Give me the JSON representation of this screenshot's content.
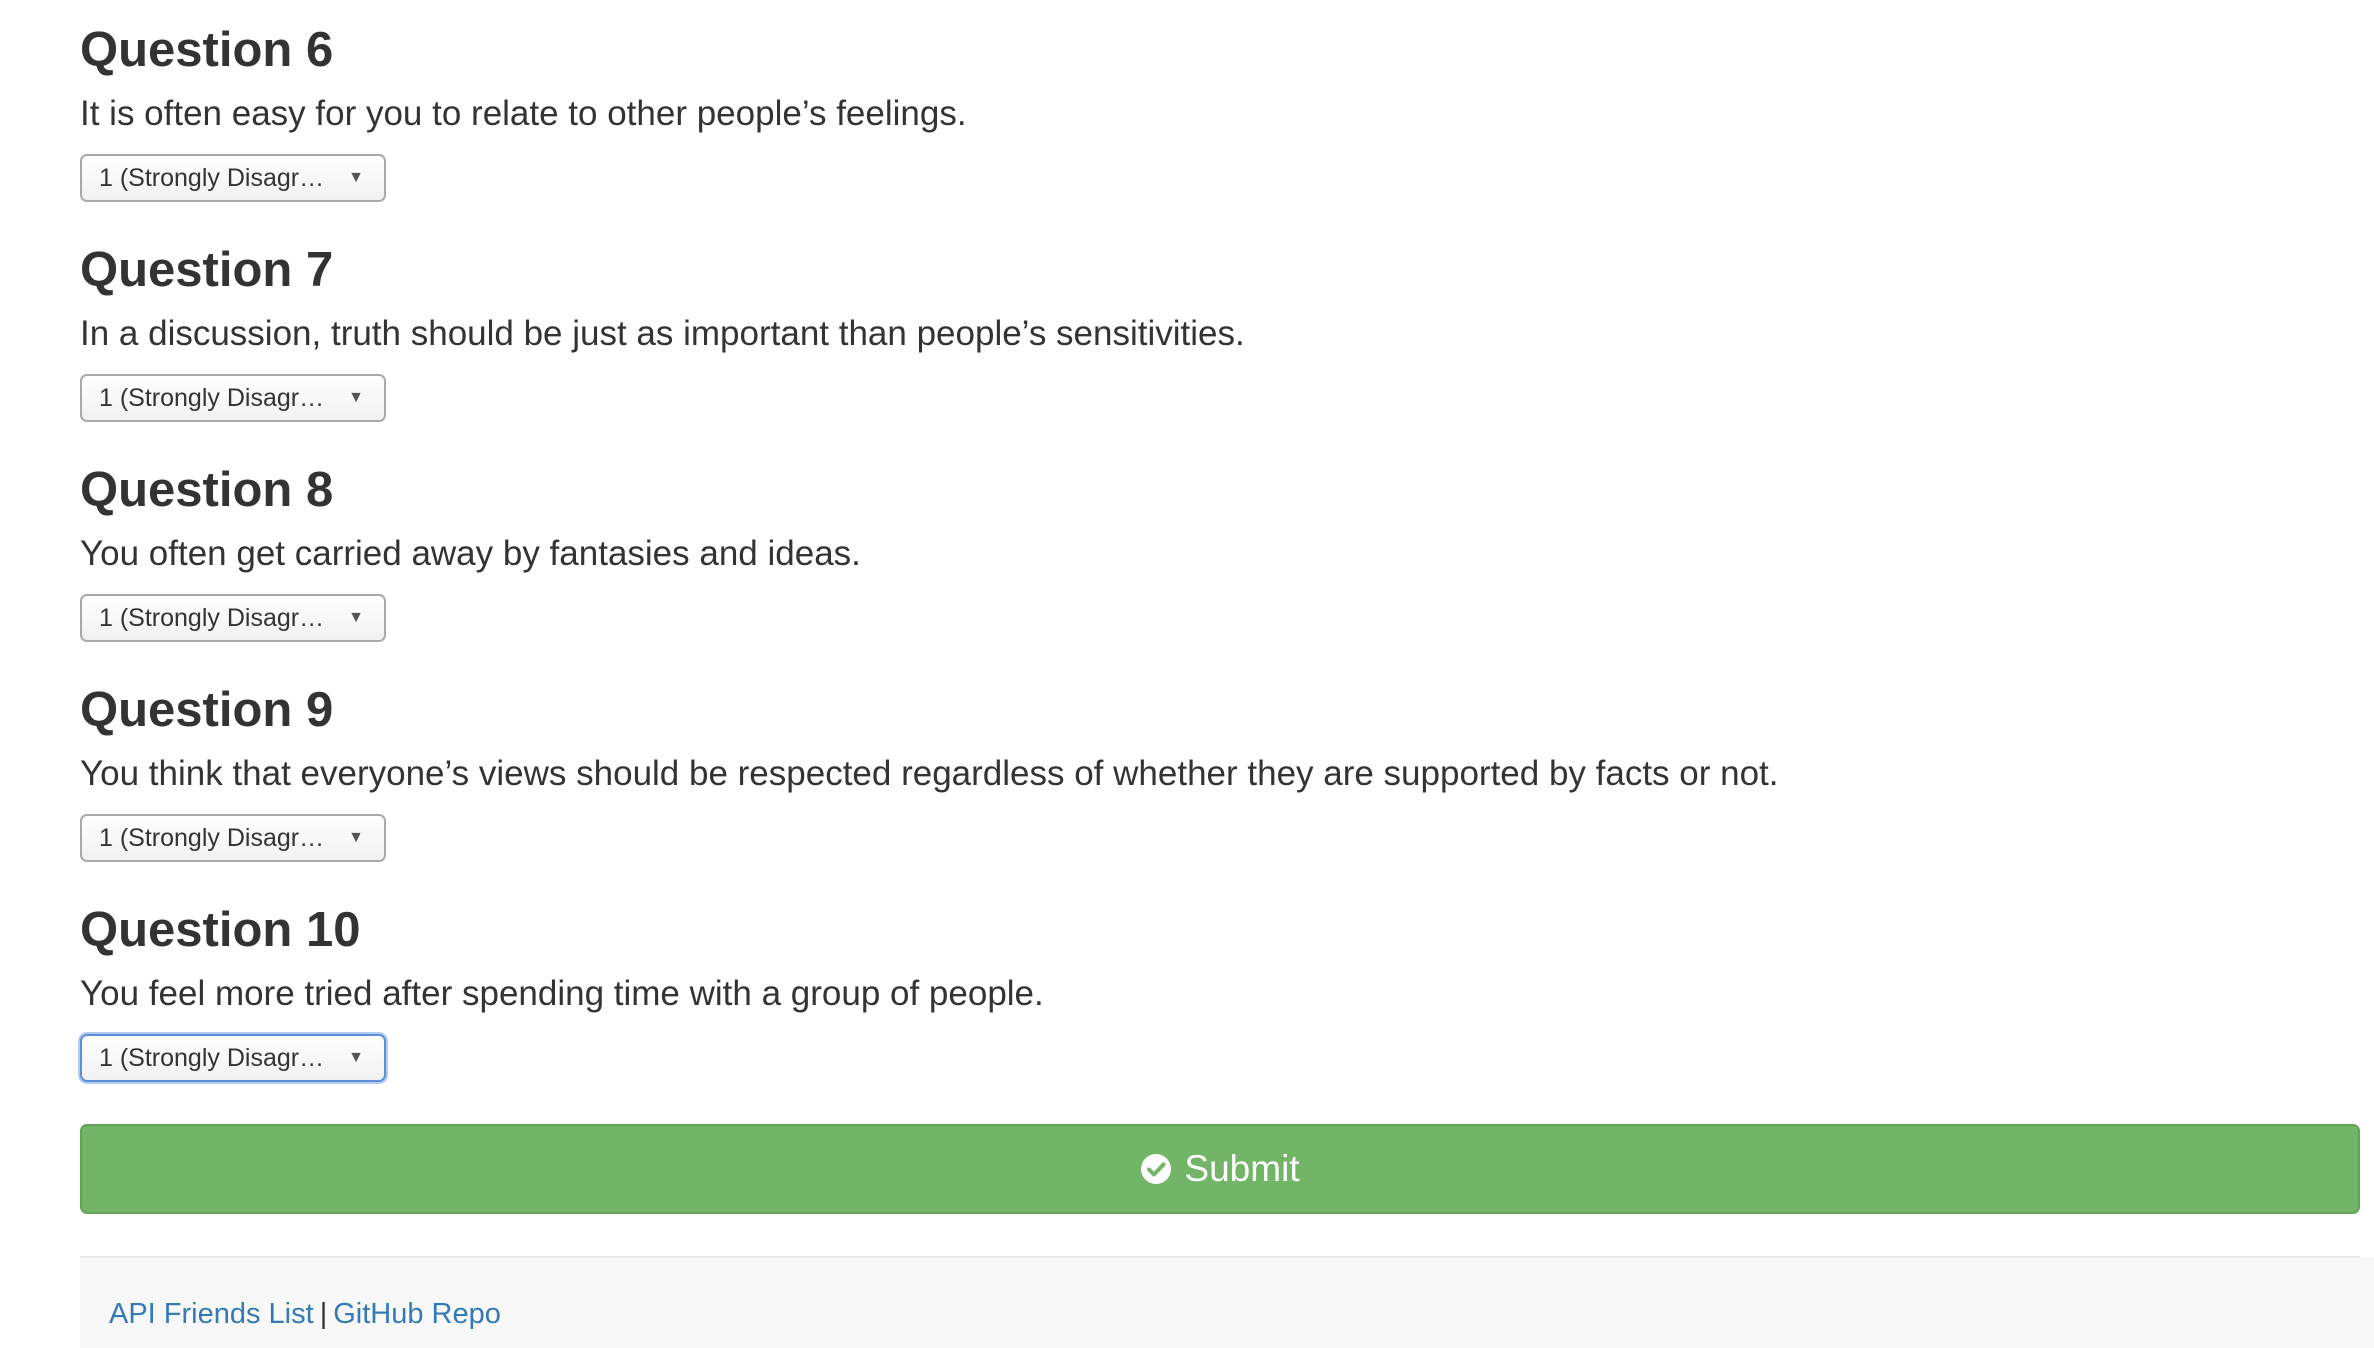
{
  "questions": [
    {
      "title": "Question 6",
      "text": "It is often easy for you to relate to other people’s feelings.",
      "selected": "1 (Strongly Disagr…"
    },
    {
      "title": "Question 7",
      "text": "In a discussion, truth should be just as important than people’s sensitivities.",
      "selected": "1 (Strongly Disagr…"
    },
    {
      "title": "Question 8",
      "text": "You often get carried away by fantasies and ideas.",
      "selected": "1 (Strongly Disagr…"
    },
    {
      "title": "Question 9",
      "text": "You think that everyone’s views should be respected regardless of whether they are supported by facts or not.",
      "selected": "1 (Strongly Disagr…"
    },
    {
      "title": "Question 10",
      "text": "You feel more tried after spending time with a group of people.",
      "selected": "1 (Strongly Disagr…"
    }
  ],
  "submit": {
    "label": "Submit",
    "icon": "check-circle-icon",
    "color": "#73b566"
  },
  "footer": {
    "links": [
      "API Friends List",
      "GitHub Repo"
    ],
    "separator": "|",
    "link_color": "#337ab7"
  },
  "focused_select": "Question 10"
}
